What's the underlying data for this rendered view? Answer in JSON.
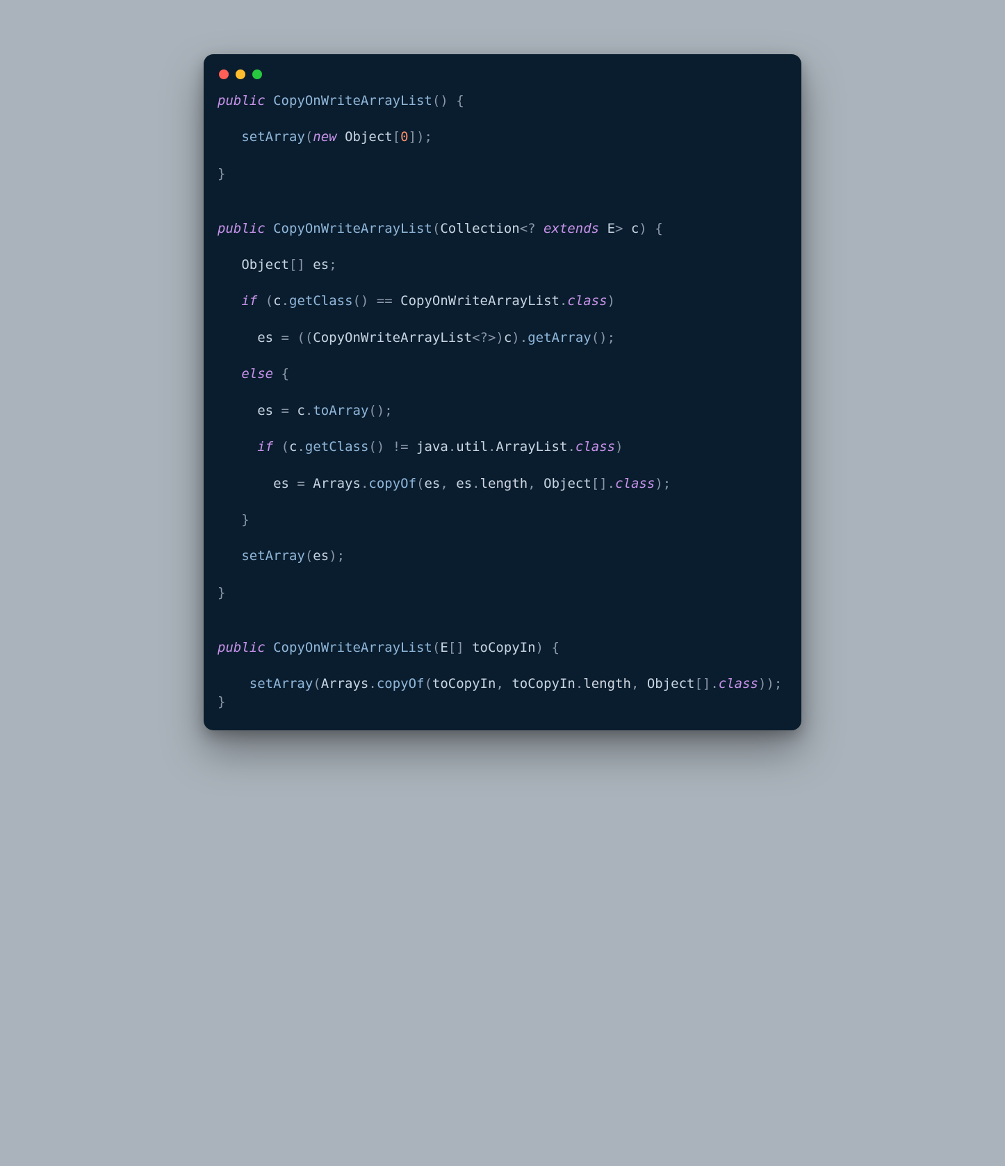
{
  "window": {
    "traffic": [
      "red",
      "yellow",
      "green"
    ]
  },
  "code": {
    "tokens": [
      {
        "c": "kw",
        "t": "public"
      },
      {
        "c": "pn",
        "t": " "
      },
      {
        "c": "fn",
        "t": "CopyOnWriteArrayList"
      },
      {
        "c": "pn",
        "t": "() {"
      },
      {
        "c": "pn",
        "t": "\n\n"
      },
      {
        "c": "pn",
        "t": "   "
      },
      {
        "c": "fn",
        "t": "setArray"
      },
      {
        "c": "pn",
        "t": "("
      },
      {
        "c": "kw",
        "t": "new"
      },
      {
        "c": "pn",
        "t": " "
      },
      {
        "c": "ty",
        "t": "Object"
      },
      {
        "c": "pn",
        "t": "["
      },
      {
        "c": "num",
        "t": "0"
      },
      {
        "c": "pn",
        "t": "]);"
      },
      {
        "c": "pn",
        "t": "\n\n"
      },
      {
        "c": "pn",
        "t": "}"
      },
      {
        "c": "pn",
        "t": "\n\n\n"
      },
      {
        "c": "kw",
        "t": "public"
      },
      {
        "c": "pn",
        "t": " "
      },
      {
        "c": "fn",
        "t": "CopyOnWriteArrayList"
      },
      {
        "c": "pn",
        "t": "("
      },
      {
        "c": "ty",
        "t": "Collection"
      },
      {
        "c": "pn",
        "t": "<? "
      },
      {
        "c": "kw",
        "t": "extends"
      },
      {
        "c": "pn",
        "t": " "
      },
      {
        "c": "ty",
        "t": "E"
      },
      {
        "c": "pn",
        "t": "> "
      },
      {
        "c": "id",
        "t": "c"
      },
      {
        "c": "pn",
        "t": ") {"
      },
      {
        "c": "pn",
        "t": "\n\n"
      },
      {
        "c": "pn",
        "t": "   "
      },
      {
        "c": "ty",
        "t": "Object"
      },
      {
        "c": "pn",
        "t": "[] "
      },
      {
        "c": "id",
        "t": "es"
      },
      {
        "c": "pn",
        "t": ";"
      },
      {
        "c": "pn",
        "t": "\n\n"
      },
      {
        "c": "pn",
        "t": "   "
      },
      {
        "c": "kw",
        "t": "if"
      },
      {
        "c": "pn",
        "t": " ("
      },
      {
        "c": "id",
        "t": "c"
      },
      {
        "c": "pn",
        "t": "."
      },
      {
        "c": "fn",
        "t": "getClass"
      },
      {
        "c": "pn",
        "t": "() == "
      },
      {
        "c": "ty",
        "t": "CopyOnWriteArrayList"
      },
      {
        "c": "pn",
        "t": "."
      },
      {
        "c": "kw",
        "t": "class"
      },
      {
        "c": "pn",
        "t": ")"
      },
      {
        "c": "pn",
        "t": "\n\n"
      },
      {
        "c": "pn",
        "t": "     "
      },
      {
        "c": "id",
        "t": "es"
      },
      {
        "c": "pn",
        "t": " = (("
      },
      {
        "c": "ty",
        "t": "CopyOnWriteArrayList"
      },
      {
        "c": "pn",
        "t": "<?>)"
      },
      {
        "c": "id",
        "t": "c"
      },
      {
        "c": "pn",
        "t": ")."
      },
      {
        "c": "fn",
        "t": "getArray"
      },
      {
        "c": "pn",
        "t": "();"
      },
      {
        "c": "pn",
        "t": "\n\n"
      },
      {
        "c": "pn",
        "t": "   "
      },
      {
        "c": "kw",
        "t": "else"
      },
      {
        "c": "pn",
        "t": " {"
      },
      {
        "c": "pn",
        "t": "\n\n"
      },
      {
        "c": "pn",
        "t": "     "
      },
      {
        "c": "id",
        "t": "es"
      },
      {
        "c": "pn",
        "t": " = "
      },
      {
        "c": "id",
        "t": "c"
      },
      {
        "c": "pn",
        "t": "."
      },
      {
        "c": "fn",
        "t": "toArray"
      },
      {
        "c": "pn",
        "t": "();"
      },
      {
        "c": "pn",
        "t": "\n\n"
      },
      {
        "c": "pn",
        "t": "     "
      },
      {
        "c": "kw",
        "t": "if"
      },
      {
        "c": "pn",
        "t": " ("
      },
      {
        "c": "id",
        "t": "c"
      },
      {
        "c": "pn",
        "t": "."
      },
      {
        "c": "fn",
        "t": "getClass"
      },
      {
        "c": "pn",
        "t": "() != "
      },
      {
        "c": "id",
        "t": "java"
      },
      {
        "c": "pn",
        "t": "."
      },
      {
        "c": "id",
        "t": "util"
      },
      {
        "c": "pn",
        "t": "."
      },
      {
        "c": "ty",
        "t": "ArrayList"
      },
      {
        "c": "pn",
        "t": "."
      },
      {
        "c": "kw",
        "t": "class"
      },
      {
        "c": "pn",
        "t": ")"
      },
      {
        "c": "pn",
        "t": "\n\n"
      },
      {
        "c": "pn",
        "t": "       "
      },
      {
        "c": "id",
        "t": "es"
      },
      {
        "c": "pn",
        "t": " = "
      },
      {
        "c": "ty",
        "t": "Arrays"
      },
      {
        "c": "pn",
        "t": "."
      },
      {
        "c": "fn",
        "t": "copyOf"
      },
      {
        "c": "pn",
        "t": "("
      },
      {
        "c": "id",
        "t": "es"
      },
      {
        "c": "pn",
        "t": ", "
      },
      {
        "c": "id",
        "t": "es"
      },
      {
        "c": "pn",
        "t": "."
      },
      {
        "c": "pr",
        "t": "length"
      },
      {
        "c": "pn",
        "t": ", "
      },
      {
        "c": "ty",
        "t": "Object"
      },
      {
        "c": "pn",
        "t": "[]."
      },
      {
        "c": "kw",
        "t": "class"
      },
      {
        "c": "pn",
        "t": ");"
      },
      {
        "c": "pn",
        "t": "\n\n"
      },
      {
        "c": "pn",
        "t": "   }"
      },
      {
        "c": "pn",
        "t": "\n\n"
      },
      {
        "c": "pn",
        "t": "   "
      },
      {
        "c": "fn",
        "t": "setArray"
      },
      {
        "c": "pn",
        "t": "("
      },
      {
        "c": "id",
        "t": "es"
      },
      {
        "c": "pn",
        "t": ");"
      },
      {
        "c": "pn",
        "t": "\n\n"
      },
      {
        "c": "pn",
        "t": "}"
      },
      {
        "c": "pn",
        "t": "\n\n\n"
      },
      {
        "c": "kw",
        "t": "public"
      },
      {
        "c": "pn",
        "t": " "
      },
      {
        "c": "fn",
        "t": "CopyOnWriteArrayList"
      },
      {
        "c": "pn",
        "t": "("
      },
      {
        "c": "ty",
        "t": "E"
      },
      {
        "c": "pn",
        "t": "[] "
      },
      {
        "c": "id",
        "t": "toCopyIn"
      },
      {
        "c": "pn",
        "t": ") {"
      },
      {
        "c": "pn",
        "t": "\n\n"
      },
      {
        "c": "pn",
        "t": "    "
      },
      {
        "c": "fn",
        "t": "setArray"
      },
      {
        "c": "pn",
        "t": "("
      },
      {
        "c": "ty",
        "t": "Arrays"
      },
      {
        "c": "pn",
        "t": "."
      },
      {
        "c": "fn",
        "t": "copyOf"
      },
      {
        "c": "pn",
        "t": "("
      },
      {
        "c": "id",
        "t": "toCopyIn"
      },
      {
        "c": "pn",
        "t": ", "
      },
      {
        "c": "id",
        "t": "toCopyIn"
      },
      {
        "c": "pn",
        "t": "."
      },
      {
        "c": "pr",
        "t": "length"
      },
      {
        "c": "pn",
        "t": ", "
      },
      {
        "c": "ty",
        "t": "Object"
      },
      {
        "c": "pn",
        "t": "[]."
      },
      {
        "c": "kw",
        "t": "class"
      },
      {
        "c": "pn",
        "t": "));"
      },
      {
        "c": "pn",
        "t": "\n"
      },
      {
        "c": "pn",
        "t": "}"
      }
    ]
  }
}
